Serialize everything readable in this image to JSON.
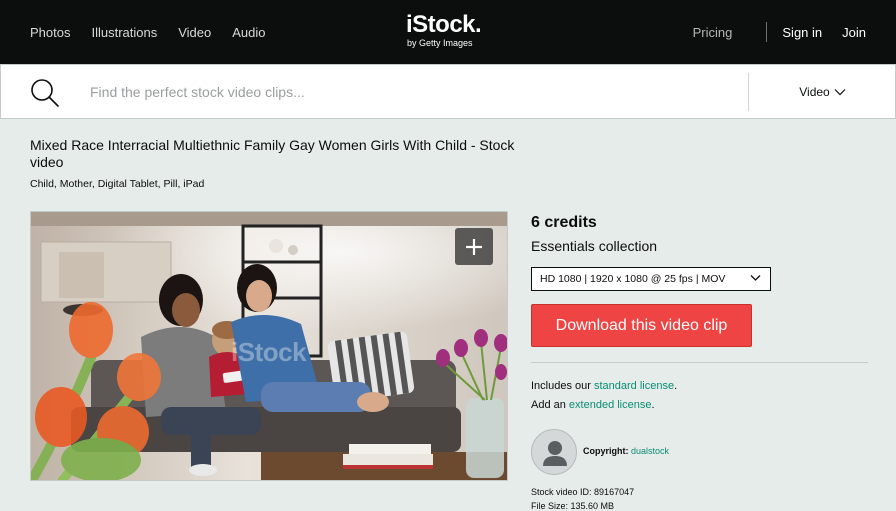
{
  "nav": {
    "links": [
      "Photos",
      "Illustrations",
      "Video",
      "Audio"
    ],
    "logo_main": "iStock.",
    "logo_sub": "by Getty Images",
    "pricing": "Pricing",
    "sign_in": "Sign in",
    "join": "Join"
  },
  "search": {
    "placeholder": "Find the perfect stock video clips...",
    "value": "",
    "type": "Video"
  },
  "asset": {
    "title": "Mixed Race Interracial Multiethnic Family Gay Women Girls With Child - Stock video",
    "tags": "Child, Mother, Digital Tablet, Pill, iPad",
    "watermark": "iStock"
  },
  "purchase": {
    "credits": "6 credits",
    "collection": "Essentials collection",
    "format": "HD 1080 | 1920 x 1080 @ 25 fps | MOV",
    "download_label": "Download this video clip",
    "license_prefix": "Includes our ",
    "license_link": "standard license",
    "license_suffix": ".",
    "extended_prefix": "Add an ",
    "extended_link": "extended license",
    "extended_suffix": "."
  },
  "contributor": {
    "copyright_label": "Copyright:",
    "name": "dualstock"
  },
  "meta": {
    "id_label": "Stock video ID:",
    "id_value": "89167047",
    "size_label": "File Size:",
    "size_value": "135.60 MB"
  },
  "colors": {
    "topbar": "#0c0d0d",
    "background": "#e6ecea",
    "download": "#ef4444",
    "link": "#0a8d73"
  }
}
